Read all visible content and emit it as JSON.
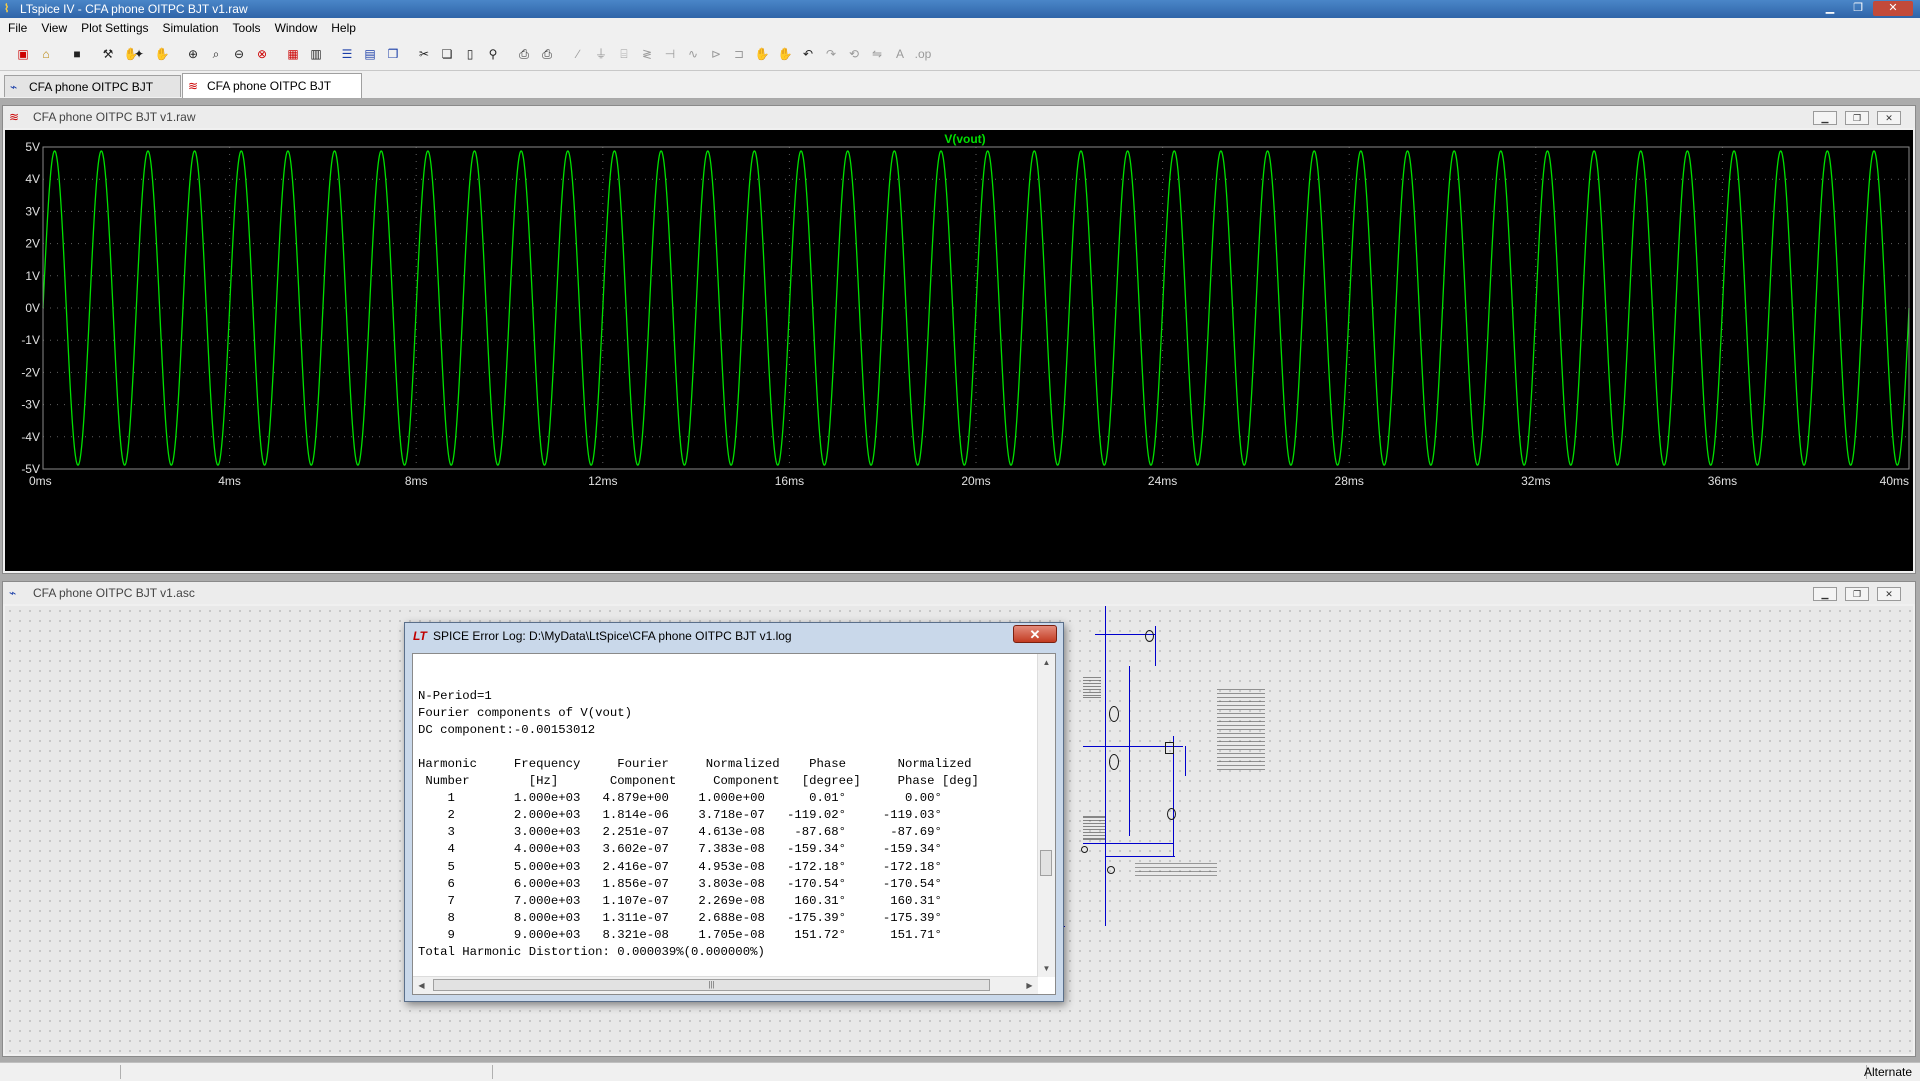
{
  "app": {
    "title": "LTspice IV - CFA phone OITPC BJT v1.raw",
    "icon": "ltspice-logo-icon"
  },
  "menu": [
    "File",
    "View",
    "Plot Settings",
    "Simulation",
    "Tools",
    "Window",
    "Help"
  ],
  "tabs": [
    {
      "label": "CFA phone OITPC BJT v1.asc",
      "icon": "schematic-icon",
      "active": false
    },
    {
      "label": "CFA phone OITPC BJT v1.raw",
      "icon": "waveform-icon",
      "active": true
    }
  ],
  "plot_window": {
    "title": "CFA phone OITPC BJT v1.raw",
    "trace_label": "V(vout)"
  },
  "schematic_window": {
    "title": "CFA phone OITPC BJT v1.asc"
  },
  "chart_data": {
    "type": "line",
    "title": "V(vout)",
    "series": [
      {
        "name": "V(vout)",
        "color": "#00e000",
        "waveform": "sine",
        "amplitude": 4.879,
        "offset": -0.00153012,
        "frequency_hz": 1000,
        "t_start_ms": 0,
        "t_end_ms": 40
      }
    ],
    "xlim": [
      0,
      40
    ],
    "ylim": [
      -5,
      5
    ],
    "x_ticks": [
      "0ms",
      "4ms",
      "8ms",
      "12ms",
      "16ms",
      "20ms",
      "24ms",
      "28ms",
      "32ms",
      "36ms",
      "40ms"
    ],
    "x_tick_values": [
      0,
      4,
      8,
      12,
      16,
      20,
      24,
      28,
      32,
      36,
      40
    ],
    "y_ticks": [
      "5V",
      "4V",
      "3V",
      "2V",
      "1V",
      "0V",
      "-1V",
      "-2V",
      "-3V",
      "-4V",
      "-5V"
    ],
    "y_tick_values": [
      5,
      4,
      3,
      2,
      1,
      0,
      -1,
      -2,
      -3,
      -4,
      -5
    ],
    "grid": true,
    "background": "#000000",
    "grid_color": "#606060",
    "axis_label_color": "#e0e0e0"
  },
  "dialog": {
    "title": "SPICE Error Log: D:\\MyData\\LtSpice\\CFA phone OITPC BJT v1.log",
    "close_symbol": "✕",
    "lines": [
      "",
      "N-Period=1",
      "Fourier components of V(vout)",
      "DC component:-0.00153012",
      "",
      "Harmonic     Frequency     Fourier     Normalized    Phase       Normalized",
      " Number        [Hz]       Component     Component   [degree]     Phase [deg]",
      "    1        1.000e+03   4.879e+00    1.000e+00      0.01°        0.00°",
      "    2        2.000e+03   1.814e-06    3.718e-07   -119.02°     -119.03°",
      "    3        3.000e+03   2.251e-07    4.613e-08    -87.68°      -87.69°",
      "    4        4.000e+03   3.602e-07    7.383e-08   -159.34°     -159.34°",
      "    5        5.000e+03   2.416e-07    4.953e-08   -172.18°     -172.18°",
      "    6        6.000e+03   1.856e-07    3.803e-08   -170.54°     -170.54°",
      "    7        7.000e+03   1.107e-07    2.269e-08    160.31°      160.31°",
      "    8        8.000e+03   1.311e-07    2.688e-08   -175.39°     -175.39°",
      "    9        9.000e+03   8.321e-08    1.705e-08    151.72°      151.71°",
      "Total Harmonic Distortion: 0.000039%(0.000000%)"
    ]
  },
  "status": {
    "text": "Alternate"
  }
}
